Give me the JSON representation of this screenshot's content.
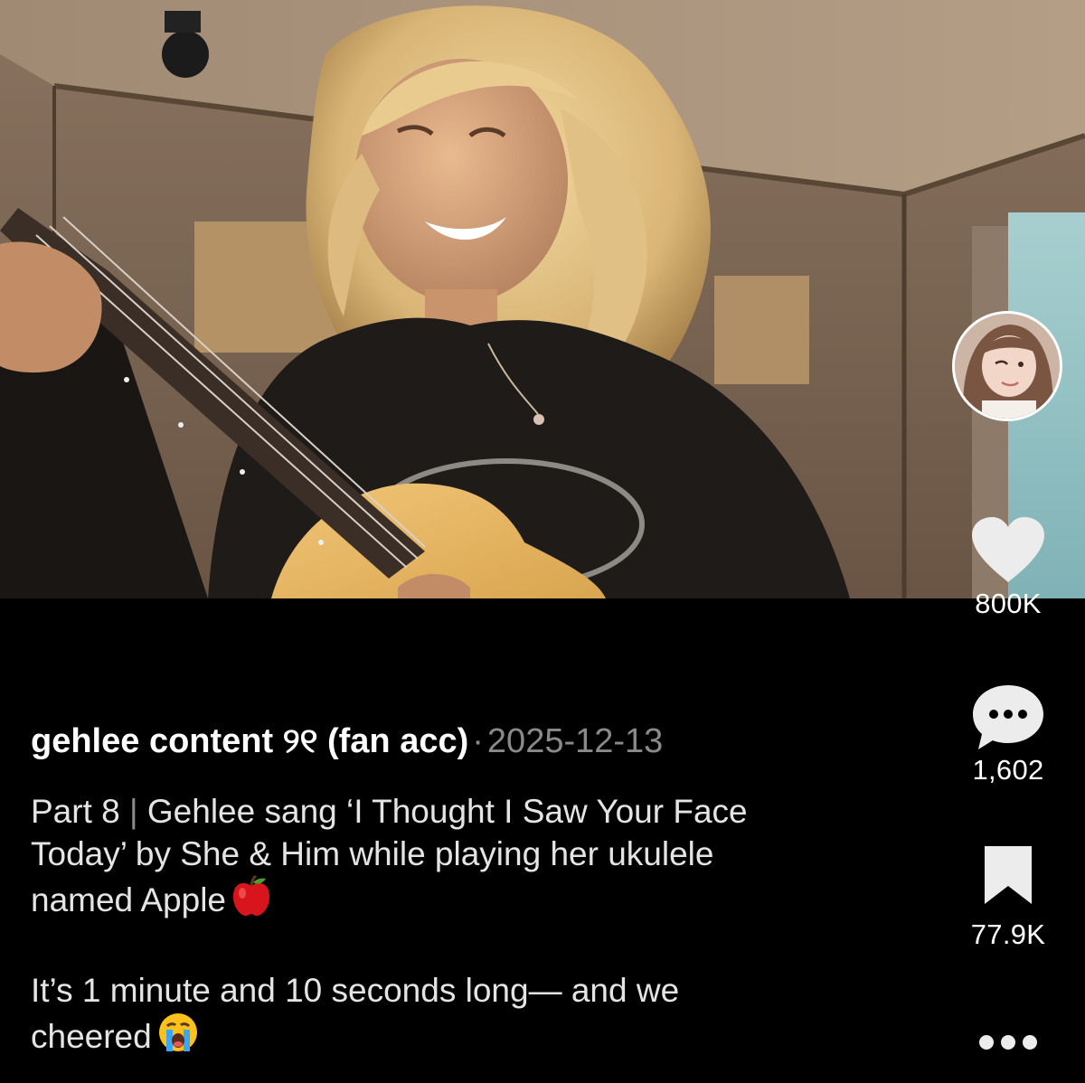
{
  "post": {
    "author": "gehlee content ୨୧ (fan acc)",
    "separator": "·",
    "date": "2025-12-13",
    "description": {
      "line1_part": "Part 8",
      "line1_divider": "|",
      "line1_rest": "Gehlee sang ‘I Thought I Saw Your Face Today’ by She & Him while playing her ukulele named Apple",
      "paragraph2": "It’s 1 minute and 10 seconds long— and we cheered"
    }
  },
  "actions": {
    "likes": "800K",
    "comments": "1,602",
    "saves": "77.9K"
  },
  "icons": {
    "avatar": "profile-avatar",
    "like": "heart-icon",
    "comment": "comment-bubble-icon",
    "save": "bookmark-icon",
    "more": "more-dots-icon",
    "apple_emoji": "red-apple-emoji",
    "cry_emoji": "loudly-crying-emoji"
  },
  "colors": {
    "background": "#000000",
    "text_primary": "#ffffff",
    "text_secondary": "#8a8a8a"
  }
}
